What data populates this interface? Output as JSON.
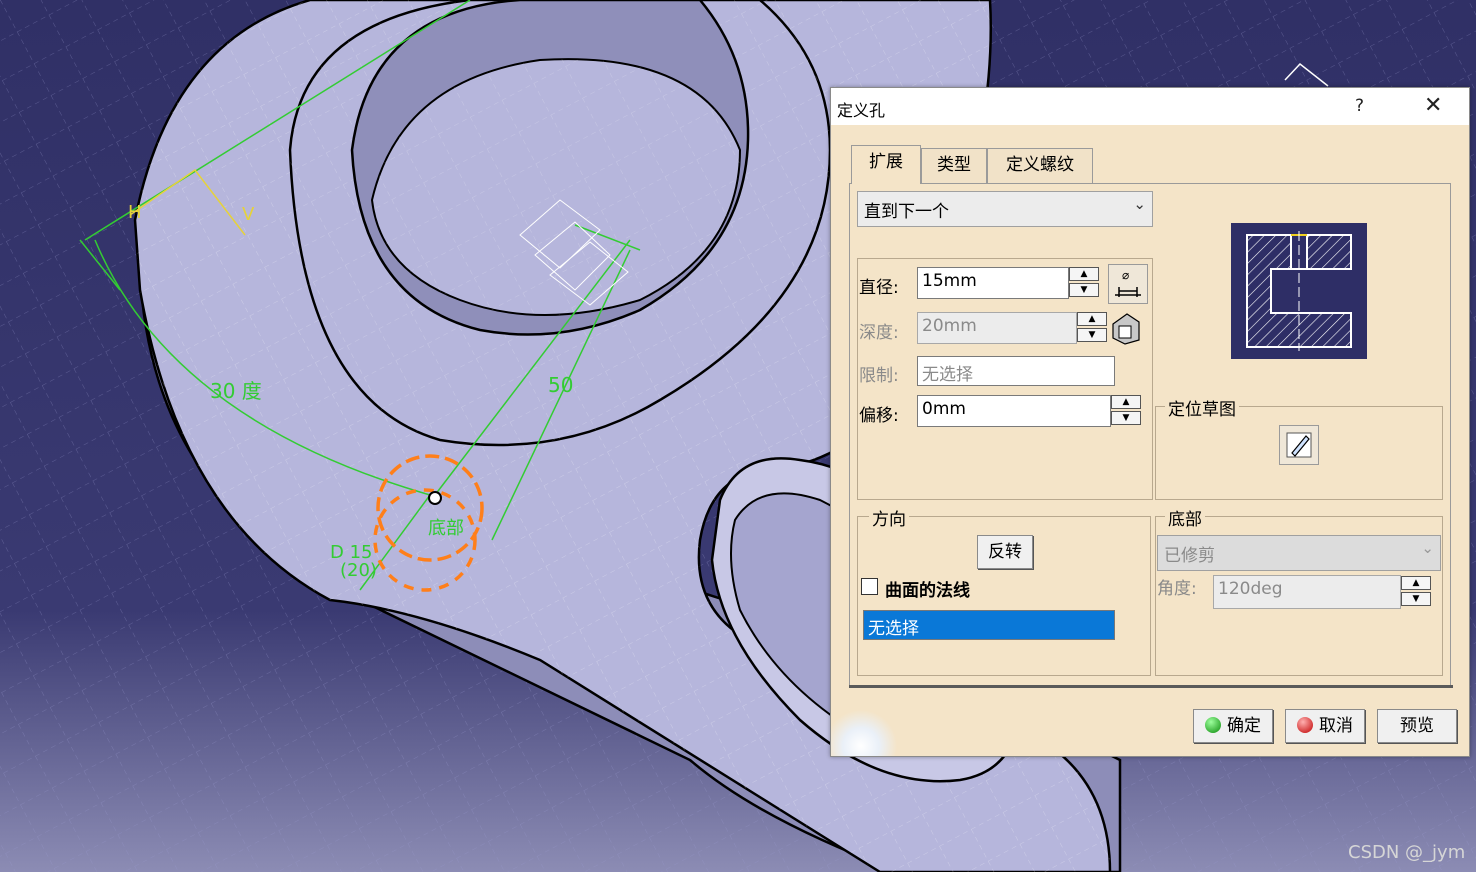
{
  "viewport": {
    "dim_30deg": "30 度",
    "dim_50": "50",
    "label_h": "H",
    "label_v": "V",
    "label_d15": "D 15",
    "label_20": "(20)",
    "label_bottom": "底部"
  },
  "dialog": {
    "title": "定义孔",
    "help": "?",
    "close": "✕",
    "tabs": [
      "扩展",
      "类型",
      "定义螺纹"
    ],
    "extension_type": "直到下一个",
    "diameter_label": "直径:",
    "diameter_value": "15mm",
    "depth_label": "深度:",
    "depth_value": "20mm",
    "limit_label": "限制:",
    "limit_value": "无选择",
    "offset_label": "偏移:",
    "offset_value": "0mm",
    "position_sketch_label": "定位草图",
    "direction_label": "方向",
    "reverse_button": "反转",
    "normal_checkbox_label": "曲面的法线",
    "direction_selection": "无选择",
    "bottom_label": "底部",
    "bottom_type": "已修剪",
    "angle_label": "角度:",
    "angle_value": "120deg",
    "ok_button": "确定",
    "cancel_button": "取消",
    "preview_button": "预览"
  },
  "watermark": "CSDN @_jym",
  "colors": {
    "viewport_bg": "#2f2f66",
    "part_face": "#b6b6dc",
    "dialog_bg": "#f4e4c8",
    "dimension_green": "#33cc33",
    "hole_orange": "#ff7f1a",
    "selection_blue": "#0a78d7"
  }
}
